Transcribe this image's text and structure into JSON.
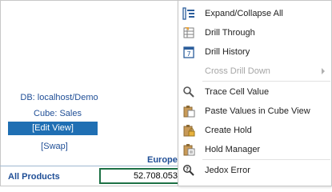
{
  "sheet": {
    "db_label": "DB: localhost/Demo",
    "cube_label": "Cube: Sales",
    "edit_view": "[Edit View]",
    "swap": "[Swap]",
    "column_header": "Europe",
    "row_header": "All Products",
    "cell_value": "52.708.053"
  },
  "menu": {
    "items": [
      {
        "label": "Expand/Collapse All",
        "icon": "expand-collapse-icon"
      },
      {
        "label": "Drill Through",
        "icon": "drill-through-icon"
      },
      {
        "label": "Drill History",
        "icon": "calendar-icon"
      },
      {
        "label": "Cross Drill Down",
        "icon": "",
        "disabled": true,
        "submenu": true
      },
      {
        "label": "Trace Cell Value",
        "icon": "magnifier-icon"
      },
      {
        "label": "Paste Values in Cube View",
        "icon": "clipboard-icon"
      },
      {
        "label": "Create Hold",
        "icon": "clipboard-lock-icon"
      },
      {
        "label": "Hold Manager",
        "icon": "clipboard-list-icon"
      },
      {
        "label": "Jedox Error",
        "icon": "error-search-icon"
      }
    ]
  },
  "colors": {
    "accent_blue": "#1f6fb3",
    "text_blue": "#1f4e96",
    "cell_border_green": "#1e7145"
  }
}
